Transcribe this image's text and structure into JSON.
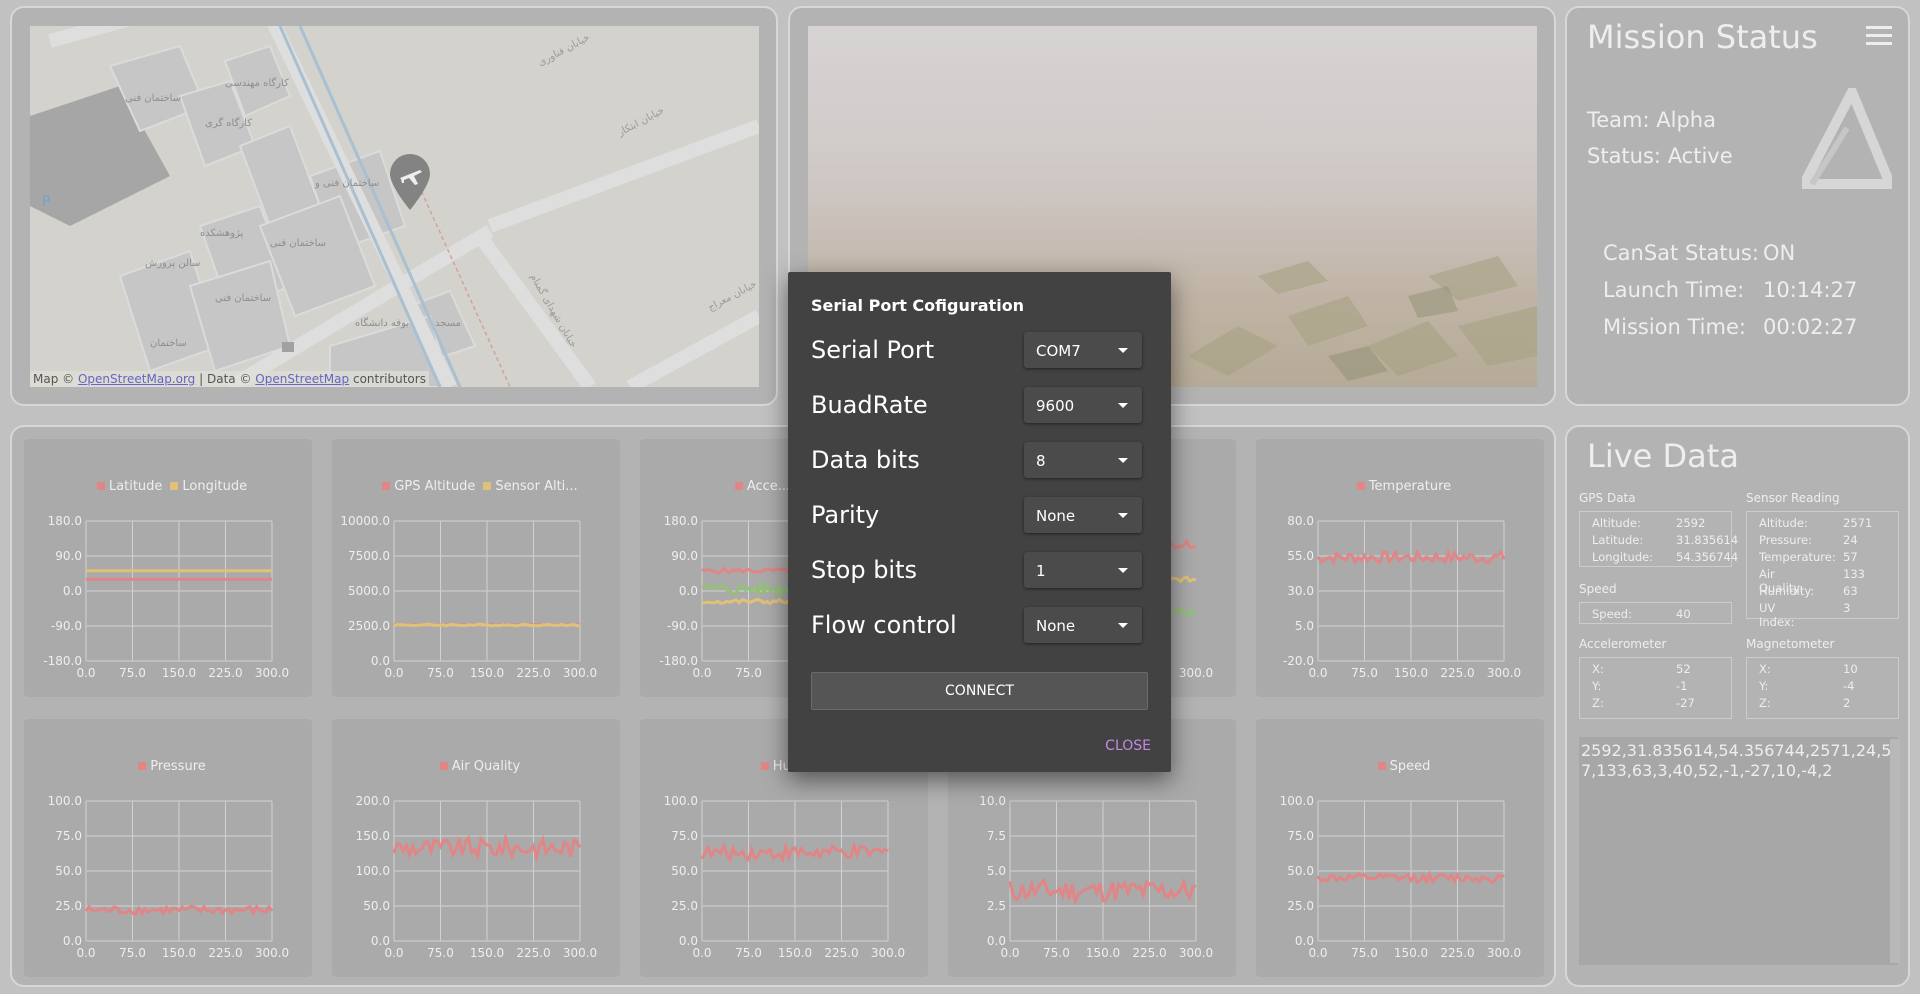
{
  "map": {
    "attribution_prefix": "Map ©",
    "attribution_link1": "OpenStreetMap.org",
    "attribution_mid": "| Data ©",
    "attribution_link2": "OpenStreetMap",
    "attribution_suffix": "contributors",
    "labels": [
      "ساختمان فنی و مهندسی ۱ دانشگاه یزد",
      "ساختمان فنی و مهندسی ۲ دانشگاه یزد",
      "ساختمان فنی و مهندسی ۳ دانشگاه یزد",
      "کارگاه آموزش فنی و مهندسی",
      "پژوهشکده علوم الهدی دانشگاه یزد",
      "سالن پرورش قارچ دانشگاه یزد",
      "بوفه دانشگاه",
      "مسجد دانشگاه یزد",
      "خیابان فناوری",
      "خیابان ابتکار",
      "خیابان معراج",
      "خیابان شهدای گمنام",
      "P"
    ]
  },
  "mission": {
    "title": "Mission Status",
    "team_label": "Team:",
    "team_value": "Alpha",
    "status_label": "Status:",
    "status_value": "Active",
    "cansat_label": "CanSat Status:",
    "cansat_value": "ON",
    "launch_label": "Launch Time:",
    "launch_value": "10:14:27",
    "mission_label": "Mission Time:",
    "mission_value": "00:02:27"
  },
  "colors": {
    "red": "#f08080",
    "yellow": "#f0c870",
    "green": "#90c870"
  },
  "charts": [
    {
      "legend": [
        {
          "name": "Latitude",
          "color": "red"
        },
        {
          "name": "Longitude",
          "color": "yellow"
        }
      ],
      "yticks": [
        "180.0",
        "90.0",
        "0.0",
        "-90.0",
        "-180.0"
      ],
      "xticks": [
        "0.0",
        "75.0",
        "150.0",
        "225.0",
        "300.0"
      ],
      "ymin": -180,
      "ymax": 180
    },
    {
      "legend": [
        {
          "name": "GPS Altitude",
          "color": "red"
        },
        {
          "name": "Sensor Alti...",
          "color": "yellow"
        }
      ],
      "yticks": [
        "10000.0",
        "7500.0",
        "5000.0",
        "2500.0",
        "0.0"
      ],
      "xticks": [
        "0.0",
        "75.0",
        "150.0",
        "225.0",
        "300.0"
      ],
      "ymin": 0,
      "ymax": 10000
    },
    {
      "legend": [
        {
          "name": "Acce...",
          "color": "red"
        },
        {
          "name": "Acce",
          "color": "green"
        }
      ],
      "yticks": [
        "180.0",
        "90.0",
        "0.0",
        "-90.0",
        "-180.0"
      ],
      "xticks": [
        "0.0",
        "75.0",
        "1"
      ],
      "ymin": -180,
      "ymax": 180
    },
    {
      "legend": [],
      "yticks": [],
      "xticks": [
        "300.0"
      ],
      "ymin": -180,
      "ymax": 180
    },
    {
      "legend": [
        {
          "name": "Temperature",
          "color": "red"
        }
      ],
      "yticks": [
        "80.0",
        "55.0",
        "30.0",
        "5.0",
        "-20.0"
      ],
      "xticks": [
        "0.0",
        "75.0",
        "150.0",
        "225.0",
        "300.0"
      ],
      "ymin": -20,
      "ymax": 80
    },
    {
      "legend": [
        {
          "name": "Pressure",
          "color": "red"
        }
      ],
      "yticks": [
        "100.0",
        "75.0",
        "50.0",
        "25.0",
        "0.0"
      ],
      "xticks": [
        "0.0",
        "75.0",
        "150.0",
        "225.0",
        "300.0"
      ],
      "ymin": 0,
      "ymax": 100
    },
    {
      "legend": [
        {
          "name": "Air Quality",
          "color": "red"
        }
      ],
      "yticks": [
        "200.0",
        "150.0",
        "100.0",
        "50.0",
        "0.0"
      ],
      "xticks": [
        "0.0",
        "75.0",
        "150.0",
        "225.0",
        "300.0"
      ],
      "ymin": 0,
      "ymax": 200
    },
    {
      "legend": [
        {
          "name": "Humid",
          "color": "red"
        }
      ],
      "yticks": [
        "100.0",
        "75.0",
        "50.0",
        "25.0",
        "0.0"
      ],
      "xticks": [
        "0.0",
        "75.0",
        "150.0",
        "225.0",
        "300.0"
      ],
      "ymin": 0,
      "ymax": 100
    },
    {
      "legend": [],
      "yticks": [
        "10.0",
        "7.5",
        "5.0",
        "2.5",
        "0.0"
      ],
      "xticks": [
        "0.0",
        "75.0",
        "150.0",
        "225.0",
        "300.0"
      ],
      "ymin": 0,
      "ymax": 10
    },
    {
      "legend": [
        {
          "name": "Speed",
          "color": "red"
        }
      ],
      "yticks": [
        "100.0",
        "75.0",
        "50.0",
        "25.0",
        "0.0"
      ],
      "xticks": [
        "0.0",
        "75.0",
        "150.0",
        "225.0",
        "300.0"
      ],
      "ymin": 0,
      "ymax": 100
    }
  ],
  "chart_series": [
    [
      {
        "color": "red",
        "level": 30,
        "noise": 0
      },
      {
        "color": "yellow",
        "level": 52,
        "noise": 0
      }
    ],
    [
      {
        "color": "red",
        "level": 2592,
        "noise": 0
      },
      {
        "color": "yellow",
        "level": 2571,
        "noise": 60
      }
    ],
    [
      {
        "color": "red",
        "level": 52,
        "noise": 6
      },
      {
        "color": "green",
        "level": 5,
        "noise": 14
      },
      {
        "color": "yellow",
        "level": -27,
        "noise": 6
      }
    ],
    [
      {
        "color": "red",
        "level": 120,
        "noise": 8
      },
      {
        "color": "yellow",
        "level": 30,
        "noise": 6
      },
      {
        "color": "green",
        "level": -55,
        "noise": 8
      }
    ],
    [
      {
        "color": "red",
        "level": 54,
        "noise": 4
      }
    ],
    [
      {
        "color": "red",
        "level": 22,
        "noise": 3
      }
    ],
    [
      {
        "color": "red",
        "level": 133,
        "noise": 14
      }
    ],
    [
      {
        "color": "red",
        "level": 63,
        "noise": 5
      }
    ],
    [
      {
        "color": "red",
        "level": 3.6,
        "noise": 0.8
      }
    ],
    [
      {
        "color": "red",
        "level": 45,
        "noise": 3
      }
    ]
  ],
  "live": {
    "title": "Live Data",
    "gps_label": "GPS Data",
    "gps": [
      {
        "k": "Altitude:",
        "v": "2592"
      },
      {
        "k": "Latitude:",
        "v": "31.835614"
      },
      {
        "k": "Longitude:",
        "v": "54.356744"
      }
    ],
    "sensor_label": "Sensor Reading",
    "sensor": [
      {
        "k": "Altitude:",
        "v": "2571"
      },
      {
        "k": "Pressure:",
        "v": "24"
      },
      {
        "k": "Temperature:",
        "v": "57"
      },
      {
        "k": "Air Quality:",
        "v": "133"
      },
      {
        "k": "Humidity:",
        "v": "63"
      },
      {
        "k": "UV Index:",
        "v": "3"
      }
    ],
    "speed_label": "Speed",
    "speed": [
      {
        "k": "Speed:",
        "v": "40"
      }
    ],
    "accel_label": "Accelerometer",
    "accel": [
      {
        "k": "X:",
        "v": "52"
      },
      {
        "k": "Y:",
        "v": "-1"
      },
      {
        "k": "Z:",
        "v": "-27"
      }
    ],
    "mag_label": "Magnetometer",
    "mag": [
      {
        "k": "X:",
        "v": "10"
      },
      {
        "k": "Y:",
        "v": "-4"
      },
      {
        "k": "Z:",
        "v": "2"
      }
    ],
    "raw": "2592,31.835614,54.356744,2571,24,57,133,63,3,40,52,-1,-27,10,-4,2"
  },
  "dialog": {
    "title": "Serial Port Cofiguration",
    "fields": [
      {
        "label": "Serial Port",
        "value": "COM7"
      },
      {
        "label": "BuadRate",
        "value": "9600"
      },
      {
        "label": "Data bits",
        "value": "8"
      },
      {
        "label": "Parity",
        "value": "None"
      },
      {
        "label": "Stop bits",
        "value": "1"
      },
      {
        "label": "Flow control",
        "value": "None"
      }
    ],
    "connect_label": "CONNECT",
    "close_label": "CLOSE"
  }
}
